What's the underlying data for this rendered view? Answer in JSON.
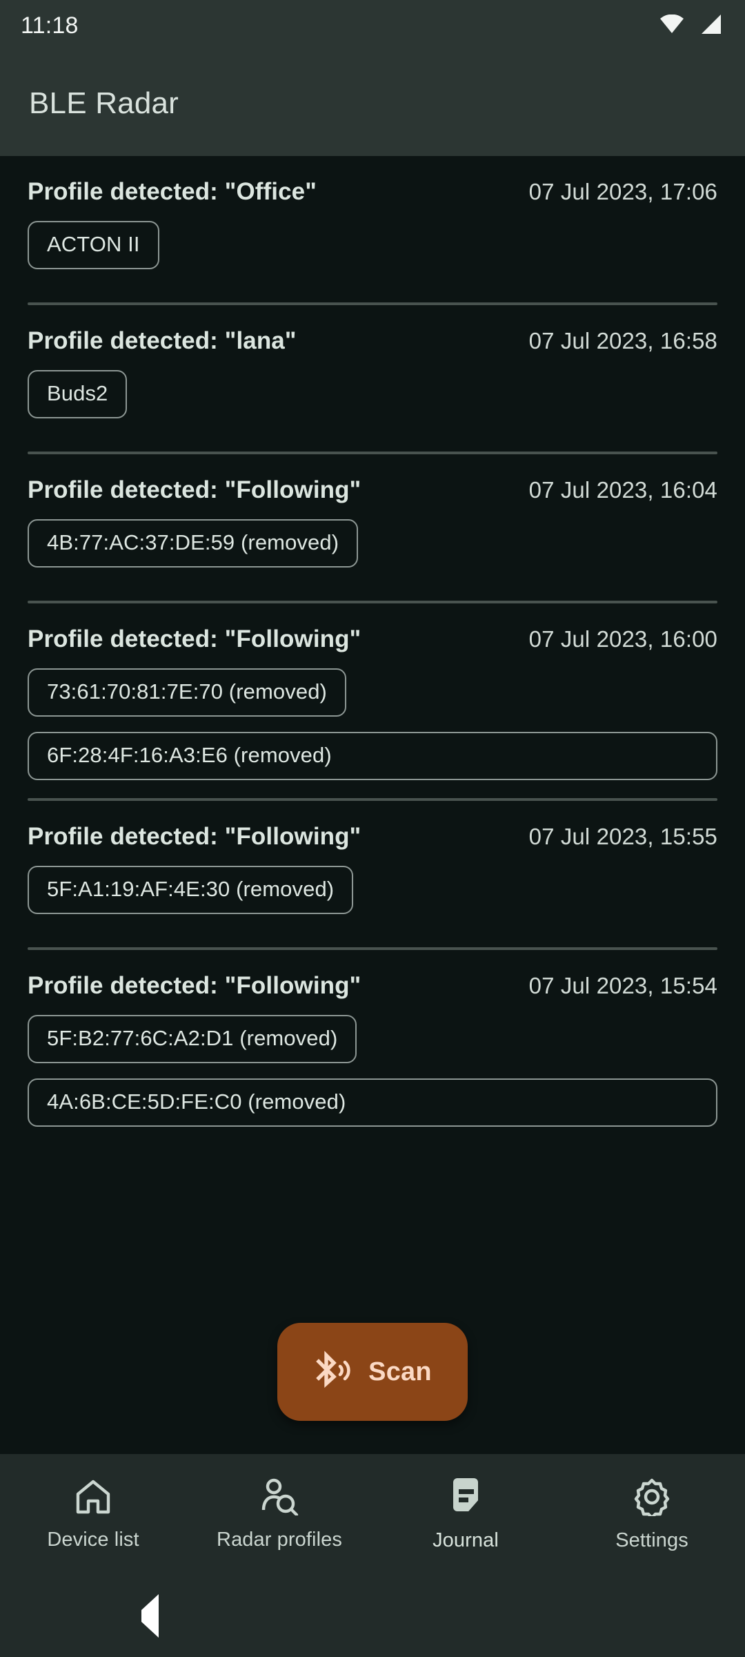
{
  "status_bar": {
    "time": "11:18",
    "icons": [
      "wifi-icon",
      "cellular-signal-icon"
    ]
  },
  "app_bar": {
    "title": "BLE Radar"
  },
  "colors": {
    "app_bar_bg": "#2C3633",
    "page_bg": "#0C1413",
    "nav_bg": "#222B29",
    "accent_fab": "#8B4517",
    "fab_text": "#FBD9C4",
    "primary_text": "#DCE6E0",
    "secondary_text": "#D2DBD6",
    "chip_border": "#8D9794",
    "divider": "#49534F"
  },
  "journal": {
    "entries": [
      {
        "title": "Profile detected: \"Office\"",
        "date": "07 Jul 2023, 17:06",
        "devices": [
          "ACTON II"
        ]
      },
      {
        "title": "Profile detected: \"lana\"",
        "date": "07 Jul 2023, 16:58",
        "devices": [
          "Buds2"
        ]
      },
      {
        "title": "Profile detected: \"Following\"",
        "date": "07 Jul 2023, 16:04",
        "devices": [
          "4B:77:AC:37:DE:59 (removed)"
        ]
      },
      {
        "title": "Profile detected: \"Following\"",
        "date": "07 Jul 2023, 16:00",
        "devices": [
          "73:61:70:81:7E:70 (removed)",
          "6F:28:4F:16:A3:E6 (removed)"
        ]
      },
      {
        "title": "Profile detected: \"Following\"",
        "date": "07 Jul 2023, 15:55",
        "devices": [
          "5F:A1:19:AF:4E:30 (removed)"
        ]
      },
      {
        "title": "Profile detected: \"Following\"",
        "date": "07 Jul 2023, 15:54",
        "devices": [
          "5F:B2:77:6C:A2:D1 (removed)",
          "4A:6B:CE:5D:FE:C0 (removed)"
        ]
      }
    ]
  },
  "fab": {
    "label": "Scan",
    "icon": "bluetooth-searching-icon"
  },
  "bottom_nav": {
    "active_index": 2,
    "items": [
      {
        "label": "Device list",
        "icon": "home-icon"
      },
      {
        "label": "Radar profiles",
        "icon": "person-search-icon"
      },
      {
        "label": "Journal",
        "icon": "note-icon"
      },
      {
        "label": "Settings",
        "icon": "gear-icon"
      }
    ]
  },
  "system_nav": {
    "back": "back-triangle-icon",
    "home": "home-circle-icon",
    "recents": "recents-square-icon"
  }
}
